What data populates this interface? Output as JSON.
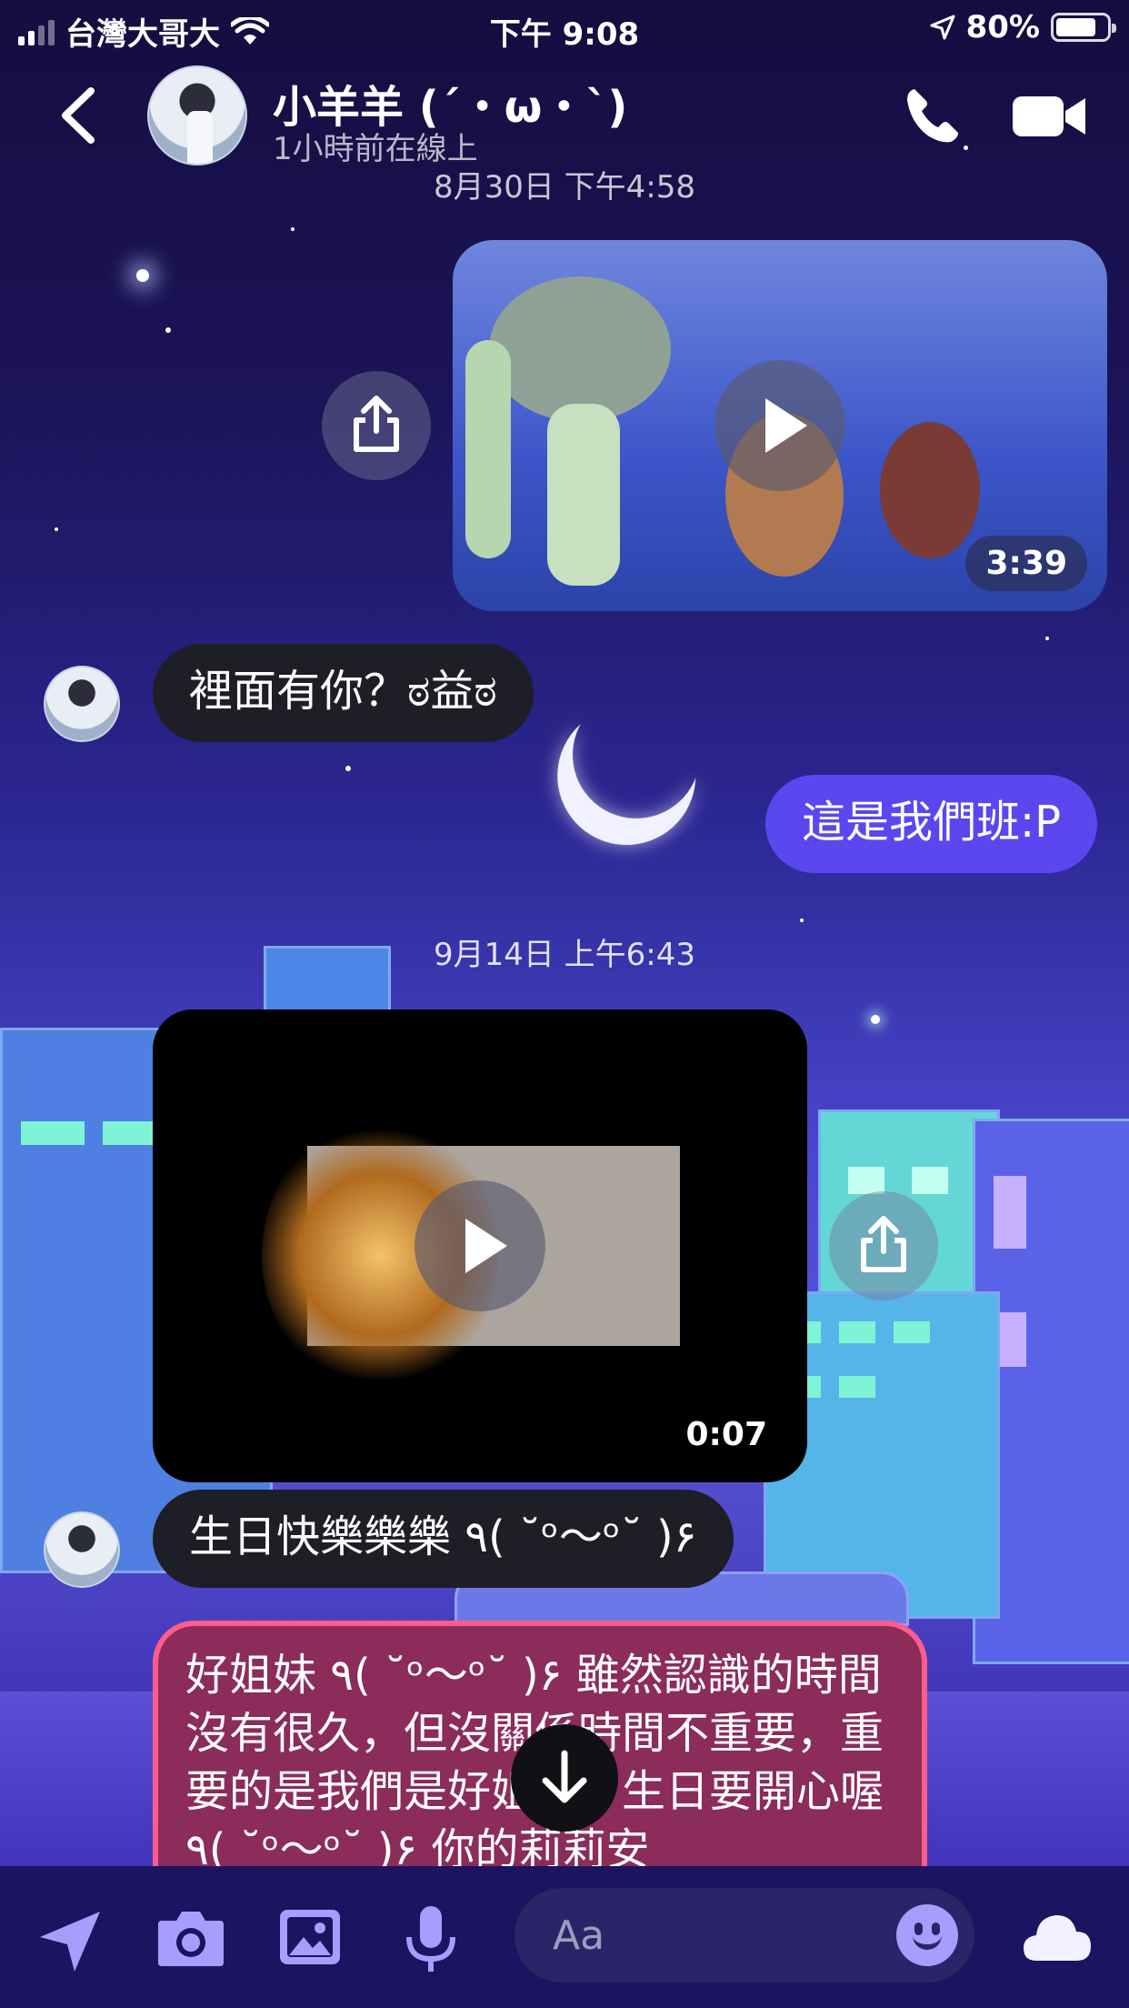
{
  "status_bar": {
    "carrier": "台灣大哥大",
    "time": "下午 9:08",
    "battery": "80%",
    "battery_level": 0.8
  },
  "header": {
    "contact_name": "小羊羊 (´・ω・`)",
    "status": "1小時前在線上"
  },
  "conversation": {
    "timestamp_1": "8月30日 下午4:58",
    "video_1_duration": "3:39",
    "msg_1": "裡面有你？ಠ益ಠ",
    "msg_2": "這是我們班:P",
    "timestamp_2": "9月14日 上午6:43",
    "video_2_duration": "0:07",
    "msg_3": "生日快樂樂樂 ٩( ˘ᵒ～ᵒ˘ )۶",
    "msg_4": "好姐妹 ٩( ˘ᵒ～ᵒ˘ )۶ 雖然認識的時間沒有很久，但沒關係時間不重要，重要的是我們是好姐妹。生日要開心喔 ٩( ˘ᵒ～ᵒ˘ )۶ 你的莉莉安"
  },
  "composer": {
    "placeholder": "Aa"
  },
  "colors": {
    "outgoing_bubble": "#5a47f0",
    "incoming_bubble": "#1e1e26",
    "highlight_bubble": "#8b2c5b",
    "highlight_border": "#ff5d8c"
  },
  "icons": [
    "back-icon",
    "phone-icon",
    "video-call-icon",
    "share-icon",
    "play-icon",
    "arrow-down-icon",
    "location-icon",
    "camera-icon",
    "image-icon",
    "microphone-icon",
    "emoji-icon",
    "cloud-icon"
  ]
}
